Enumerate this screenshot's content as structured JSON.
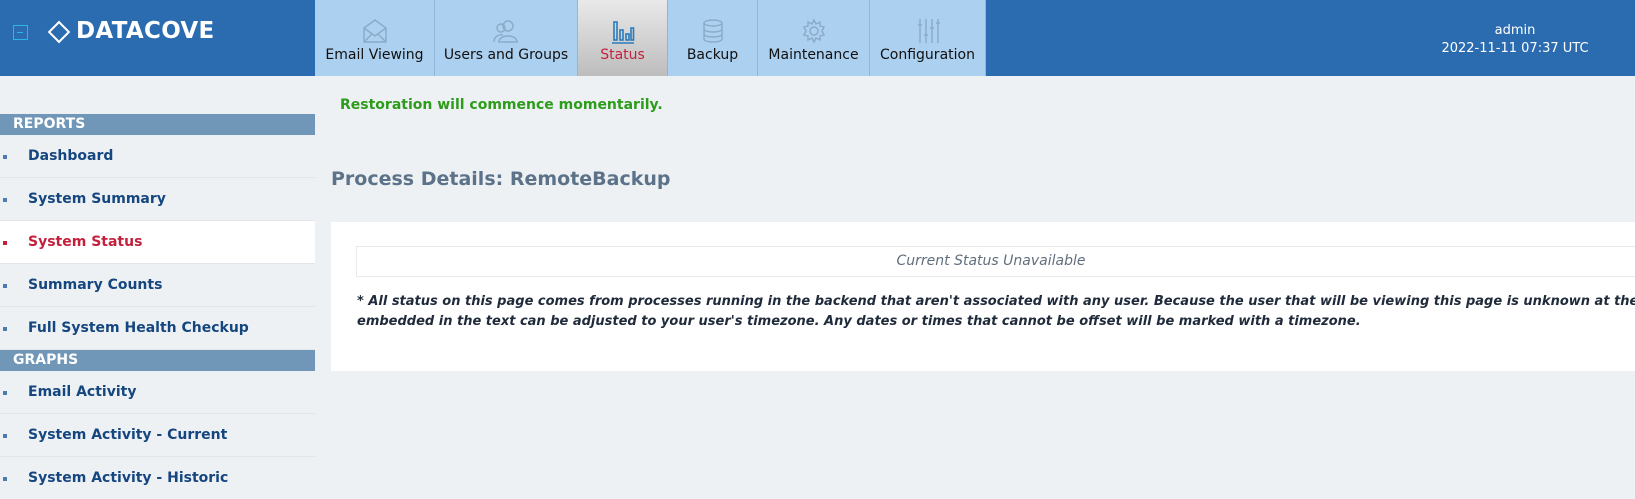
{
  "brand": {
    "name": "DATACOVE"
  },
  "icons": {
    "collapse": "collapse-icon",
    "logo": "diamond-logo-icon",
    "tabs": [
      "envelope-icon",
      "users-icon",
      "bar-chart-icon",
      "database-icon",
      "gear-icon",
      "sliders-icon"
    ]
  },
  "colors": {
    "header": "#2b6cb0",
    "tab": "#acd0ef",
    "active": "#c4203d",
    "success": "#2c9c1a",
    "nav_text": "#15467f",
    "section": "#7096b8"
  },
  "tabs": [
    {
      "label": "Email Viewing"
    },
    {
      "label": "Users and Groups"
    },
    {
      "label": "Status",
      "active": true
    },
    {
      "label": "Backup"
    },
    {
      "label": "Maintenance"
    },
    {
      "label": "Configuration"
    }
  ],
  "user": {
    "name": "admin",
    "datetime": "2022-11-11 07:37 UTC"
  },
  "sidebar": {
    "reports_header": "REPORTS",
    "reports": [
      {
        "label": "Dashboard"
      },
      {
        "label": "System Summary"
      },
      {
        "label": "System Status",
        "active": true
      },
      {
        "label": "Summary Counts"
      },
      {
        "label": "Full System Health Checkup"
      }
    ],
    "graphs_header": "GRAPHS",
    "graphs": [
      {
        "label": "Email Activity"
      },
      {
        "label": "System Activity - Current"
      },
      {
        "label": "System Activity - Historic"
      }
    ]
  },
  "main": {
    "alert": "Restoration will commence momentarily.",
    "title": "Process Details: RemoteBackup",
    "status": "Current Status Unavailable",
    "note_line1": "* All status on this page comes from processes running in the backend that aren't associated with any user. Because the user that will be viewing this page is unknown at the time of the creation of the status",
    "note_line2": "embedded in the text can be adjusted to your user's timezone. Any dates or times that cannot be offset will be marked with a timezone."
  }
}
